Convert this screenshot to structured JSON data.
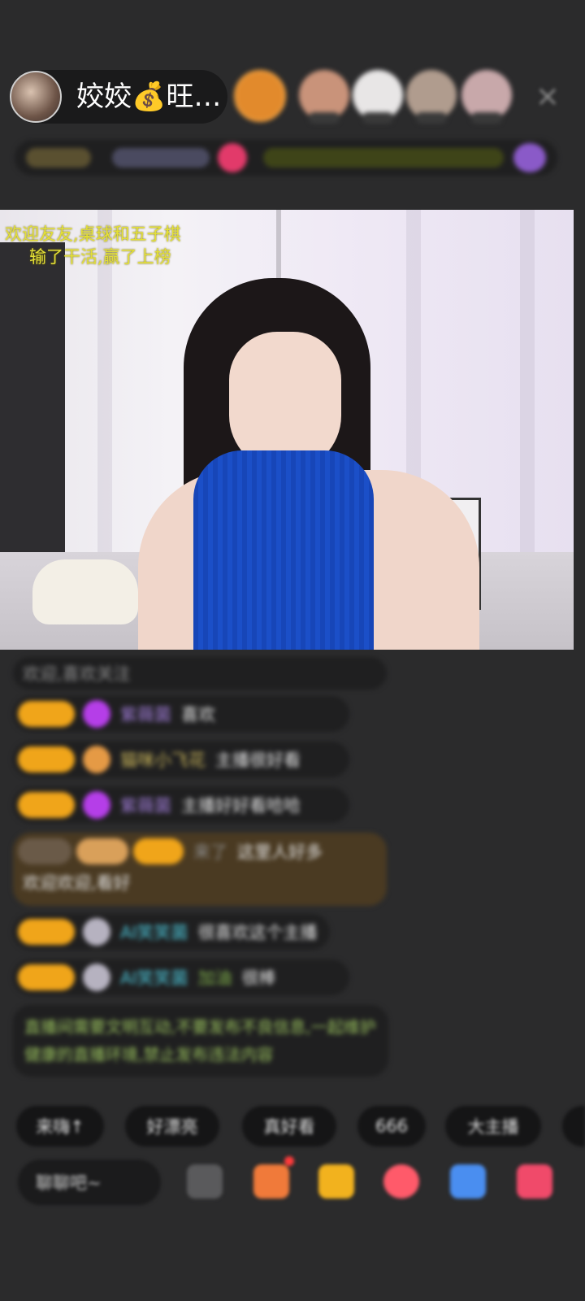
{
  "header": {
    "host_name": "姣姣💰旺…",
    "close_icon": "close-icon"
  },
  "video": {
    "overlay_line1": "欢迎友友,桌球和五子棋",
    "overlay_line2": "输了干活,赢了上榜"
  },
  "chat": {
    "messages": [
      {
        "text": "欢迎,喜欢关注"
      },
      {
        "name": "紫薇菌",
        "text": "喜欢"
      },
      {
        "name": "猫咪小飞花",
        "text": "主播很好看"
      },
      {
        "name": "紫薇菌",
        "text": "主播好好看哈哈"
      },
      {
        "name": "来了",
        "text": "这里人好多",
        "extra": "欢迎欢迎,看好"
      },
      {
        "name": "AI笑笑菌",
        "text": "很喜欢这个主播"
      },
      {
        "name": "AI笑笑菌",
        "text": "加油",
        "extra": "很棒"
      },
      {
        "text": "直播间需要文明互动,不要发布不良信息,一起维护健康的直播环境,禁止发布违法内容"
      }
    ]
  },
  "quick_replies": [
    "来嗨↑",
    "好漂亮",
    "真好看",
    "666",
    "大主播"
  ],
  "bottom_bar": {
    "input_placeholder": "聊聊吧~",
    "icons": [
      "emoji-icon",
      "gift-box-icon",
      "red-packet-icon",
      "heart-gift-icon",
      "game-icon",
      "more-icon"
    ]
  },
  "colors": {
    "background": "#2b2b2c",
    "badge": "#f0a51a",
    "overlay_text": "#e3df38",
    "accent_red": "#ff3b3b"
  }
}
